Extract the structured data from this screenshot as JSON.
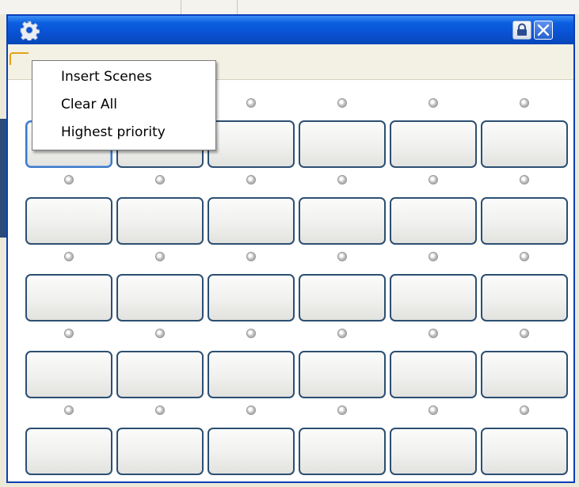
{
  "window": {
    "icons": {
      "app": "gear-icon",
      "lock": "lock-icon",
      "close": "close-icon"
    },
    "colors": {
      "titlebar": "#0a52d4",
      "slot_border": "#2c4f72",
      "menu_border": "#7a7a7a"
    }
  },
  "context_menu": {
    "items": [
      {
        "label": "Insert Scenes"
      },
      {
        "label": "Clear All"
      },
      {
        "label": "Highest priority"
      }
    ]
  },
  "scene_grid": {
    "rows": 5,
    "columns": 6,
    "selected_slot": {
      "row": 1,
      "column": 1
    },
    "indicator_state": "off"
  }
}
